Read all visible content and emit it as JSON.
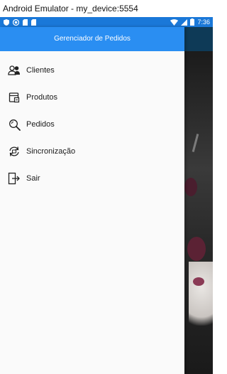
{
  "window": {
    "title": "Android Emulator - my_device:5554"
  },
  "statusbar": {
    "time": "7:36",
    "color": "#1a78d8"
  },
  "drawer": {
    "header_title": "Gerenciador de Pedidos",
    "header_color": "#2a8ef2",
    "items": [
      {
        "label": "Clientes",
        "icon": "users-icon"
      },
      {
        "label": "Produtos",
        "icon": "product-box-icon"
      },
      {
        "label": "Pedidos",
        "icon": "search-orders-icon"
      },
      {
        "label": "Sincronização",
        "icon": "sync-icon"
      },
      {
        "label": "Sair",
        "icon": "exit-icon"
      }
    ]
  }
}
